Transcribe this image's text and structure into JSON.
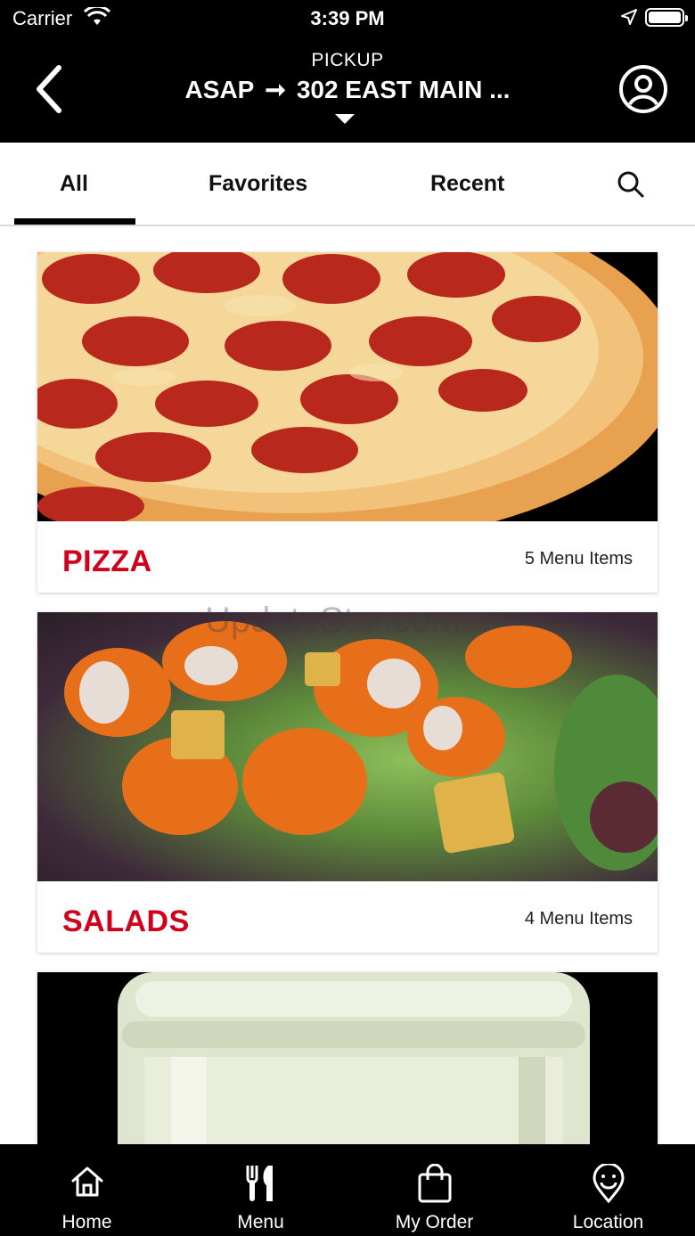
{
  "status_bar": {
    "carrier": "Carrier",
    "time": "3:39 PM"
  },
  "header": {
    "mode": "PICKUP",
    "when": "ASAP",
    "arrow": "➞",
    "location": "302 EAST MAIN ..."
  },
  "tabs": [
    {
      "label": "All",
      "active": true
    },
    {
      "label": "Favorites",
      "active": false
    },
    {
      "label": "Recent",
      "active": false
    }
  ],
  "categories": [
    {
      "title": "PIZZA",
      "count": "5 Menu Items",
      "image": "pepperoni-pizza"
    },
    {
      "title": "SALADS",
      "count": "4 Menu Items",
      "image": "buffalo-chicken-salad"
    },
    {
      "title": "",
      "count": "",
      "image": "drink-jar"
    }
  ],
  "watermark": "UpdateStar.com",
  "bottom_nav": [
    {
      "label": "Home",
      "icon": "home-icon"
    },
    {
      "label": "Menu",
      "icon": "fork-knife-icon"
    },
    {
      "label": "My Order",
      "icon": "shopping-bag-icon"
    },
    {
      "label": "Location",
      "icon": "location-pin-icon"
    }
  ],
  "colors": {
    "accent": "#d0021b",
    "bar": "#000000"
  }
}
